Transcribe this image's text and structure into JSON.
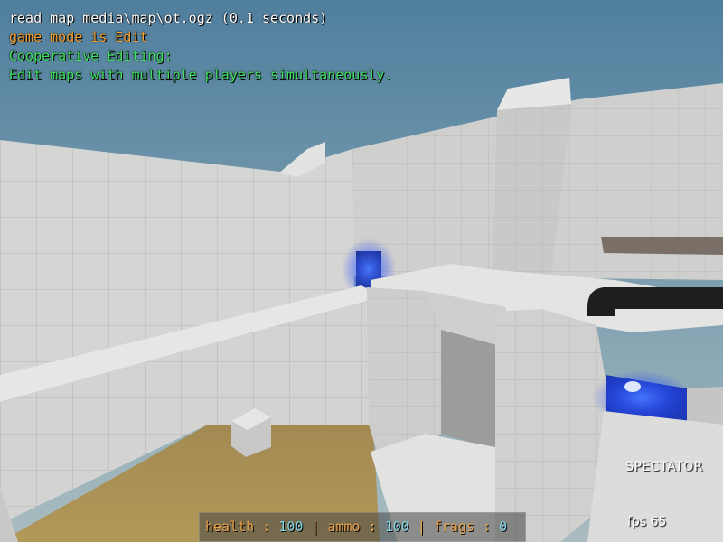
{
  "console": {
    "lines": [
      {
        "text": "read map media\\map\\ot.ogz (0.1 seconds)",
        "color": "#ffffff"
      },
      {
        "text": "game mode is Edit",
        "color": "#f0a030"
      },
      {
        "text": "Cooperative Editing:",
        "color": "#40e060"
      },
      {
        "text": "Edit maps with multiple players simultaneously.",
        "color": "#40e060"
      }
    ]
  },
  "status": {
    "spectator": "SPECTATOR",
    "fps_label": "fps",
    "fps_value": "65"
  },
  "hud": {
    "health_label": "health",
    "health_value": "100",
    "ammo_label": "ammo",
    "ammo_value": "100",
    "frags_label": "frags",
    "frags_value": "0",
    "separator_colon": ":",
    "separator_bar": "|"
  },
  "colors": {
    "sky_top": "#4f81a0",
    "sky_bottom": "#9fb6bd",
    "wall": "#d4d4d2",
    "floor": "#a88e52",
    "blue_light": "#2a5cff",
    "label": "#e8a24a",
    "value": "#7fd6e6"
  }
}
